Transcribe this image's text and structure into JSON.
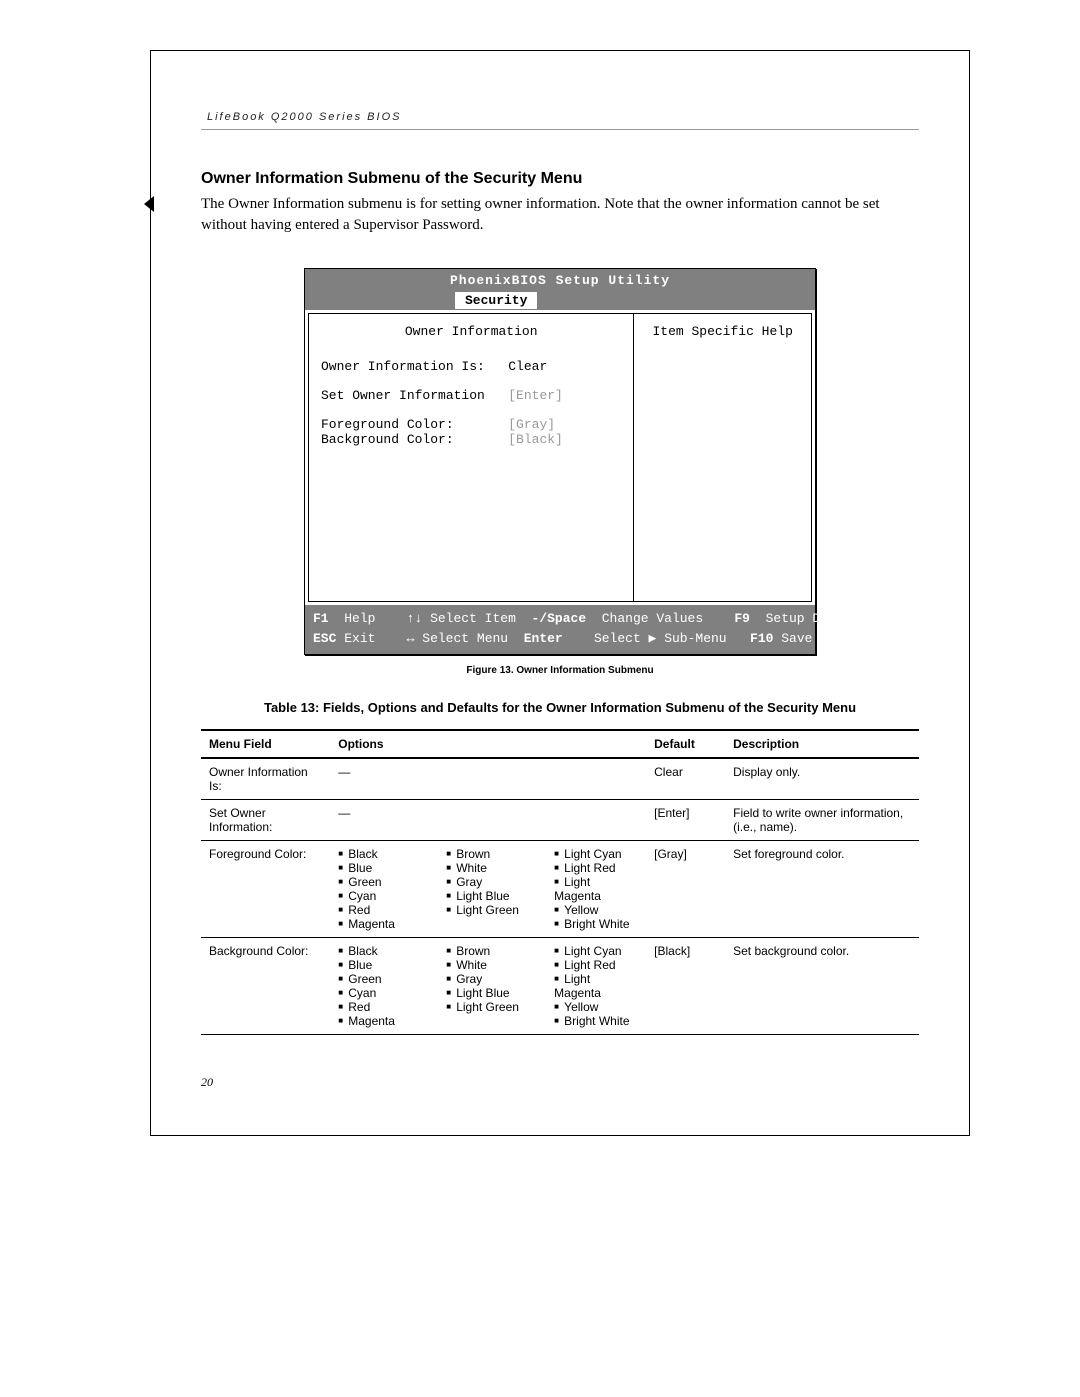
{
  "running_head": "LifeBook Q2000 Series BIOS",
  "section_heading": "Owner Information Submenu of the Security Menu",
  "intro": "The Owner Information submenu is for setting owner information. Note that the owner information cannot be set without having entered a Supervisor Password.",
  "bios": {
    "title": "PhoenixBIOS Setup Utility",
    "active_tab": "Security",
    "left_panel_title": "Owner Information",
    "help_panel_title": "Item Specific Help",
    "rows": {
      "owner_info_is_label": "Owner Information Is:",
      "owner_info_is_value": "Clear",
      "set_owner_info_label": "Set Owner Information",
      "set_owner_info_value": "[Enter]",
      "fg_label": "Foreground Color:",
      "fg_value": "[Gray]",
      "bg_label": "Background Color:",
      "bg_value": "[Black]"
    },
    "footer": {
      "f1": "F1",
      "help": "Help",
      "arrows_ud": "↑↓",
      "select_item": "Select Item",
      "minus_space": "-/Space",
      "change_values": "Change Values",
      "f9": "F9",
      "setup_defaults": "Setup Defaults",
      "esc": "ESC",
      "exit": "Exit",
      "arrows_lr": "↔",
      "select_menu": "Select Menu",
      "enter": "Enter",
      "select_submenu": "Select ▶ Sub-Menu",
      "f10": "F10",
      "save_exit": "Save and Exit"
    }
  },
  "figure_caption": "Figure 13.  Owner Information Submenu",
  "table_caption": "Table 13: Fields, Options and Defaults for the Owner Information Submenu of the Security Menu",
  "columns": {
    "c1": "Menu Field",
    "c2": "Options",
    "c3": "Default",
    "c4": "Description"
  },
  "table_rows": [
    {
      "menu": "Owner Information Is:",
      "opts_text": "—",
      "default": "Clear",
      "desc": "Display only."
    },
    {
      "menu": "Set Owner Information:",
      "opts_text": "—",
      "default": "[Enter]",
      "desc": "Field to write owner informa­tion, (i.e., name)."
    },
    {
      "menu": "Foreground Color:",
      "default": "[Gray]",
      "desc": "Set foreground color.",
      "opts_cols": [
        [
          "Black",
          "Blue",
          "Green",
          "Cyan",
          "Red",
          "Magenta"
        ],
        [
          "Brown",
          "White",
          "Gray",
          "Light Blue",
          "Light Green"
        ],
        [
          "Light Cyan",
          "Light Red",
          "Light Magenta",
          "Yellow",
          "Bright White"
        ]
      ]
    },
    {
      "menu": "Background Color:",
      "default": "[Black]",
      "desc": "Set background color.",
      "opts_cols": [
        [
          "Black",
          "Blue",
          "Green",
          "Cyan",
          "Red",
          "Magenta"
        ],
        [
          "Brown",
          "White",
          "Gray",
          "Light Blue",
          "Light Green"
        ],
        [
          "Light Cyan",
          "Light Red",
          "Light Magenta",
          "Yellow",
          "Bright White"
        ]
      ]
    }
  ],
  "page_number": "20"
}
